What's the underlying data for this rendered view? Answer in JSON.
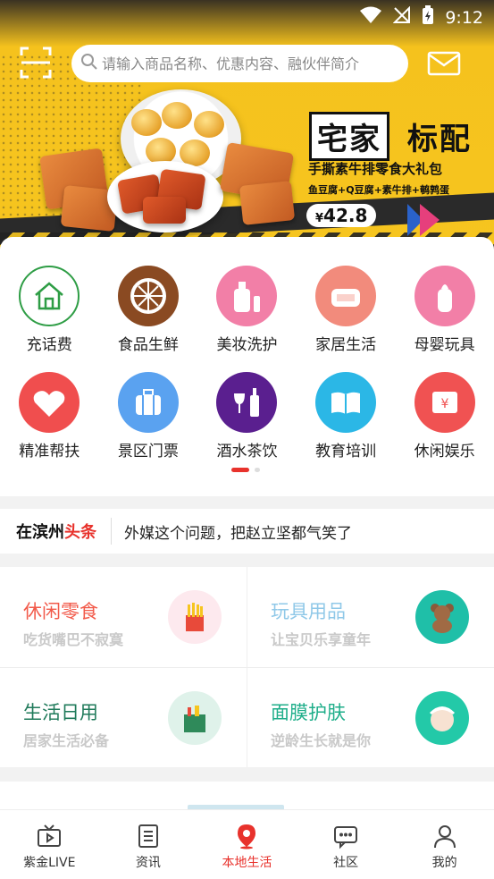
{
  "status_bar": {
    "time": "9:12"
  },
  "search": {
    "placeholder": "请输入商品名称、优惠内容、融伙伴简介"
  },
  "banner": {
    "title_part1": "宅家",
    "title_part2": "标配",
    "subtitle": "手撕素牛排零食大礼包",
    "ingredients": "鱼豆腐+Q豆腐+素牛排+鹌鹑蛋",
    "price_symbol": "¥",
    "price": "42.8"
  },
  "categories": [
    {
      "label": "充话费",
      "icon": "house-icon",
      "color": "#2e9d45"
    },
    {
      "label": "食品生鲜",
      "icon": "orange-slice-icon",
      "color": "#8a4a22"
    },
    {
      "label": "美妆洗护",
      "icon": "cosmetics-icon",
      "color": "#f27fa7"
    },
    {
      "label": "家居生活",
      "icon": "sofa-icon",
      "color": "#f28b7c"
    },
    {
      "label": "母婴玩具",
      "icon": "baby-bottle-icon",
      "color": "#f27fa7"
    },
    {
      "label": "精准帮扶",
      "icon": "heart-handshake-icon",
      "color": "#f04e4e"
    },
    {
      "label": "景区门票",
      "icon": "luggage-icon",
      "color": "#5aa2f0"
    },
    {
      "label": "酒水茶饮",
      "icon": "wine-icon",
      "color": "#5a1f8f"
    },
    {
      "label": "教育培训",
      "icon": "book-icon",
      "color": "#2bb7e6"
    },
    {
      "label": "休闲娱乐",
      "icon": "ticket-icon",
      "color": "#f05252"
    }
  ],
  "headline": {
    "brand_prefix": "在滨州",
    "brand_suffix": "头条",
    "text": "外媒这个问题，把赵立坚都气笑了"
  },
  "promos": [
    {
      "title": "休闲零食",
      "subtitle": "吃货嘴巴不寂寞",
      "color": "#f25a4a",
      "icon": "fries-icon"
    },
    {
      "title": "玩具用品",
      "subtitle": "让宝贝乐享童年",
      "color": "#8fc8e8",
      "icon": "teddy-bear-icon"
    },
    {
      "title": "生活日用",
      "subtitle": "居家生活必备",
      "color": "#1f7a5a",
      "icon": "grocery-bag-icon"
    },
    {
      "title": "面膜护肤",
      "subtitle": "逆龄生长就是你",
      "color": "#1fae8a",
      "icon": "face-mask-icon"
    }
  ],
  "tabs": [
    {
      "label": "紫金LIVE",
      "icon": "tv-icon"
    },
    {
      "label": "资讯",
      "icon": "news-list-icon"
    },
    {
      "label": "本地生活",
      "icon": "location-pin-icon",
      "active": true
    },
    {
      "label": "社区",
      "icon": "chat-bubble-icon"
    },
    {
      "label": "我的",
      "icon": "user-icon"
    }
  ],
  "colors": {
    "accent": "#e8322c",
    "banner_yellow": "#f6c51f"
  }
}
